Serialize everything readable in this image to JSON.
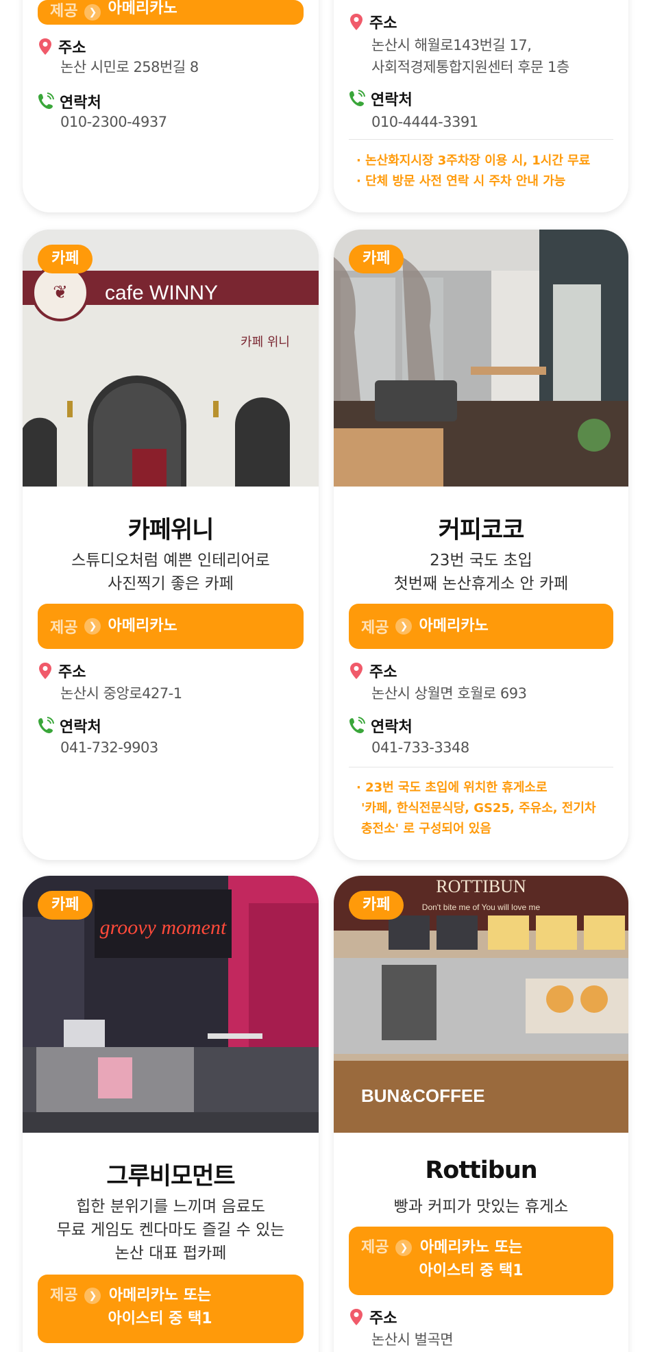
{
  "colors": {
    "accent": "#ff9a0a",
    "pin": "#f05a6a",
    "phone": "#3aa63a"
  },
  "labels": {
    "address": "주소",
    "contact": "연락처",
    "offer_prefix": "제공",
    "tag": "카페"
  },
  "cards": [
    {
      "offer": "아메리카노",
      "address": "논산 시민로 258번길 8",
      "phone": "010-2300-4937"
    },
    {
      "address_lines": [
        "논산시 해월로143번길 17,",
        "사회적경제통합지원센터 후문 1층"
      ],
      "phone": "010-4444-3391",
      "notes": [
        "· 논산화지시장 3주차장 이용 시, 1시간 무료",
        "· 단체 방문 사전 연락 시 주차 안내 가능"
      ]
    },
    {
      "photo_sign": "cafe WINNY",
      "photo_sub": "카페 위니",
      "title": "카페위니",
      "desc_lines": [
        "스튜디오처럼 예쁜 인테리어로",
        "사진찍기 좋은 카페"
      ],
      "offer": "아메리카노",
      "address": "논산시 중앙로427-1",
      "phone": "041-732-9903"
    },
    {
      "title": "커피코코",
      "desc_lines": [
        "23번 국도 초입",
        "첫번째 논산휴게소 안 카페"
      ],
      "offer": "아메리카노",
      "address": "논산시 상월면 호월로 693",
      "phone": "041-733-3348",
      "notes": [
        "· 23번 국도 초입에 위치한 휴게소로",
        "'카페, 한식전문식당, GS25, 주유소, 전기차",
        "충전소' 로 구성되어 있음"
      ]
    },
    {
      "photo_sign": "groovy moment",
      "title": "그루비모먼트",
      "desc_lines": [
        "힙한 분위기를 느끼며 음료도",
        "무료 게임도 켄다마도 즐길 수 있는",
        "논산 대표 펍카페"
      ],
      "offer_lines": [
        "아메리카노 또는",
        "아이스티 중 택1"
      ]
    },
    {
      "photo_sign": "ROTTIBUN",
      "photo_sub": "Don't bite me of You will love me",
      "photo_counter": "BUN&COFFEE",
      "title": "Rottibun",
      "desc_lines": [
        "빵과 커피가 맛있는 휴게소"
      ],
      "offer_lines": [
        "아메리카노 또는",
        "아이스티 중 택1"
      ],
      "address": "논산시 벌곡면"
    }
  ]
}
